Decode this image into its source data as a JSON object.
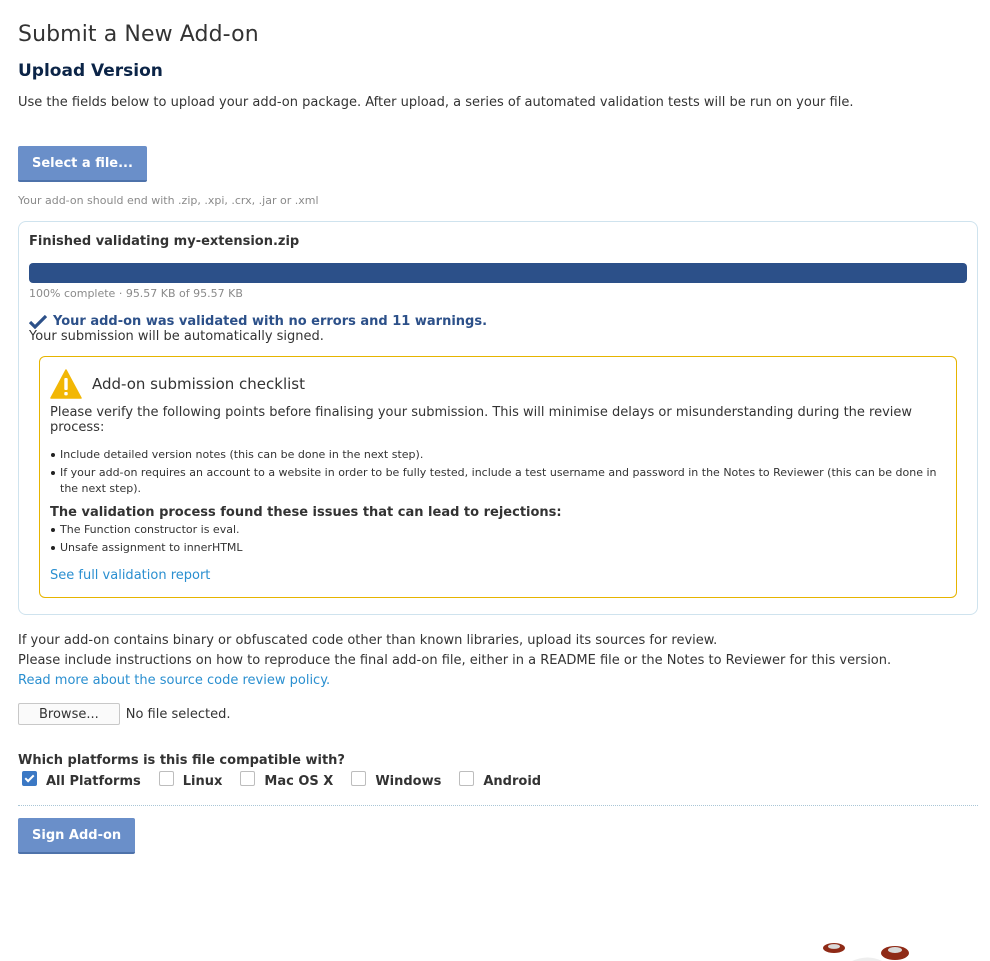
{
  "page": {
    "title": "Submit a New Add-on",
    "section_title": "Upload Version",
    "intro": "Use the fields below to upload your add-on package. After upload, a series of automated validation tests will be run on your file."
  },
  "upload": {
    "select_button": "Select a file...",
    "hint": "Your add-on should end with .zip, .xpi, .crx, .jar or .xml"
  },
  "validation": {
    "finished_text": "Finished validating my-extension.zip",
    "progress_percent": 100,
    "progress_text": "100% complete · 95.57 KB of 95.57 KB",
    "result_text": "Your add-on was validated with no errors and 11 warnings.",
    "signed_text": "Your submission will be automatically signed."
  },
  "checklist": {
    "title": "Add-on submission checklist",
    "description": "Please verify the following points before finalising your submission. This will minimise delays or misunderstanding during the review process:",
    "items": [
      "Include detailed version notes (this can be done in the next step).",
      "If your add-on requires an account to a website in order to be fully tested, include a test username and password in the Notes to Reviewer (this can be done in the next step)."
    ],
    "issues_title": "The validation process found these issues that can lead to rejections:",
    "issues": [
      "The Function constructor is eval.",
      "Unsafe assignment to innerHTML"
    ],
    "report_link": "See full validation report"
  },
  "source": {
    "line1": "If your add-on contains binary or obfuscated code other than known libraries, upload its sources for review.",
    "line2": "Please include instructions on how to reproduce the final add-on file, either in a README file or the Notes to Reviewer for this version.",
    "policy_link": "Read more about the source code review policy.",
    "browse_button": "Browse...",
    "no_file": "No file selected."
  },
  "platforms": {
    "question": "Which platforms is this file compatible with?",
    "options": [
      {
        "label": "All Platforms",
        "checked": true
      },
      {
        "label": "Linux",
        "checked": false
      },
      {
        "label": "Mac OS X",
        "checked": false
      },
      {
        "label": "Windows",
        "checked": false
      },
      {
        "label": "Android",
        "checked": false
      }
    ]
  },
  "actions": {
    "sign_button": "Sign Add-on"
  },
  "colors": {
    "primary_button": "#6a8fc9",
    "progress_bar": "#2c5089",
    "link": "#2a8fd0",
    "checklist_border": "#e6b400",
    "warning_icon": "#f2b705"
  }
}
